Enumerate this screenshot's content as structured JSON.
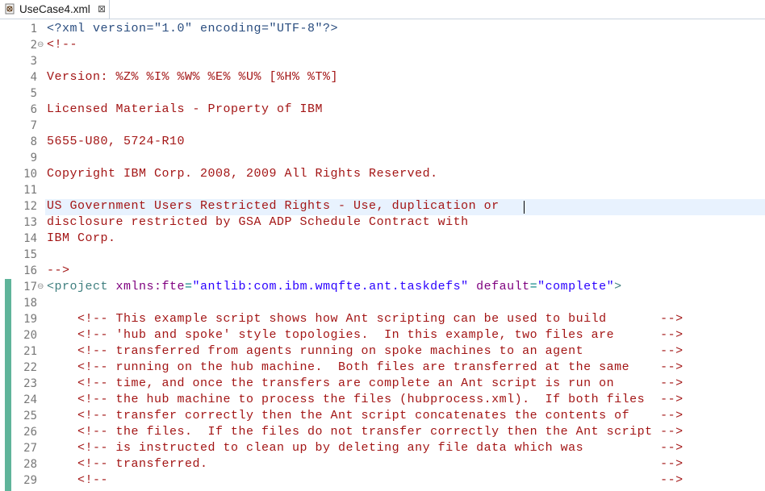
{
  "tab": {
    "title": "UseCase4.xml",
    "close_glyph": "⊠",
    "icon": "xml-file-icon"
  },
  "editor": {
    "lines": [
      {
        "n": "1",
        "text": "<?xml version=\"1.0\" encoding=\"UTF-8\"?>"
      },
      {
        "n": "2",
        "text": "<!--",
        "fold": "⊖"
      },
      {
        "n": "3",
        "text": ""
      },
      {
        "n": "4",
        "text": "Version: %Z% %I% %W% %E% %U% [%H% %T%]"
      },
      {
        "n": "5",
        "text": ""
      },
      {
        "n": "6",
        "text": "Licensed Materials - Property of IBM"
      },
      {
        "n": "7",
        "text": ""
      },
      {
        "n": "8",
        "text": "5655-U80, 5724-R10"
      },
      {
        "n": "9",
        "text": ""
      },
      {
        "n": "10",
        "text": "Copyright IBM Corp. 2008, 2009 All Rights Reserved."
      },
      {
        "n": "11",
        "text": ""
      },
      {
        "n": "12",
        "text": "US Government Users Restricted Rights - Use, duplication or"
      },
      {
        "n": "13",
        "text": "disclosure restricted by GSA ADP Schedule Contract with"
      },
      {
        "n": "14",
        "text": "IBM Corp."
      },
      {
        "n": "15",
        "text": ""
      },
      {
        "n": "16",
        "text": "-->"
      },
      {
        "n": "17",
        "fold": "⊖",
        "tag_open": "<project ",
        "attr1": "xmlns:fte",
        "eq1": "=",
        "val1": "\"antlib:com.ibm.wmqfte.ant.taskdefs\"",
        "attr2": " default",
        "eq2": "=",
        "val2": "\"complete\"",
        "tag_close": ">"
      },
      {
        "n": "18",
        "text": ""
      },
      {
        "n": "19",
        "text": "    <!-- This example script shows how Ant scripting can be used to build       -->"
      },
      {
        "n": "20",
        "text": "    <!-- 'hub and spoke' style topologies.  In this example, two files are      -->"
      },
      {
        "n": "21",
        "text": "    <!-- transferred from agents running on spoke machines to an agent          -->"
      },
      {
        "n": "22",
        "text": "    <!-- running on the hub machine.  Both files are transferred at the same    -->"
      },
      {
        "n": "23",
        "text": "    <!-- time, and once the transfers are complete an Ant script is run on      -->"
      },
      {
        "n": "24",
        "text": "    <!-- the hub machine to process the files (hubprocess.xml).  If both files  -->"
      },
      {
        "n": "25",
        "text": "    <!-- transfer correctly then the Ant script concatenates the contents of    -->"
      },
      {
        "n": "26",
        "text": "    <!-- the files.  If the files do not transfer correctly then the Ant script -->"
      },
      {
        "n": "27",
        "text": "    <!-- is instructed to clean up by deleting any file data which was          -->"
      },
      {
        "n": "28",
        "text": "    <!-- transferred.                                                           -->"
      },
      {
        "n": "29",
        "text": "    <!--                                                                        -->"
      }
    ]
  }
}
